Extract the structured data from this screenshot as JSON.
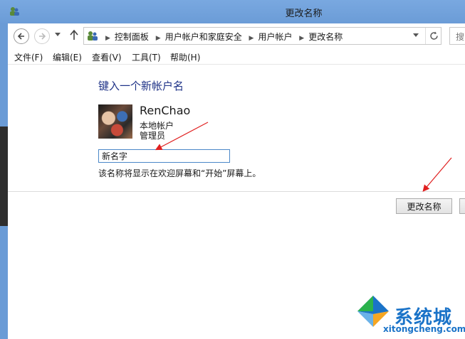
{
  "window": {
    "title": "更改名称"
  },
  "nav": {
    "breadcrumbs": [
      "控制面板",
      "用户帐户和家庭安全",
      "用户帐户",
      "更改名称"
    ],
    "search_placeholder": "搜"
  },
  "menu": {
    "items": [
      "文件(F)",
      "编辑(E)",
      "查看(V)",
      "工具(T)",
      "帮助(H)"
    ]
  },
  "main": {
    "heading": "键入一个新帐户名",
    "account": {
      "name": "RenChao",
      "type": "本地帐户",
      "role": "管理员"
    },
    "new_name_value": "新名字",
    "hint": "该名称将显示在欢迎屏幕和“开始”屏幕上。",
    "change_button": "更改名称"
  },
  "watermark": {
    "brand": "系统城",
    "url": "xitongcheng.com"
  },
  "colors": {
    "titlebar": "#6b9cd7",
    "heading": "#1e3287",
    "annotation_arrow": "#e02020",
    "watermark": "#1a73c8"
  }
}
